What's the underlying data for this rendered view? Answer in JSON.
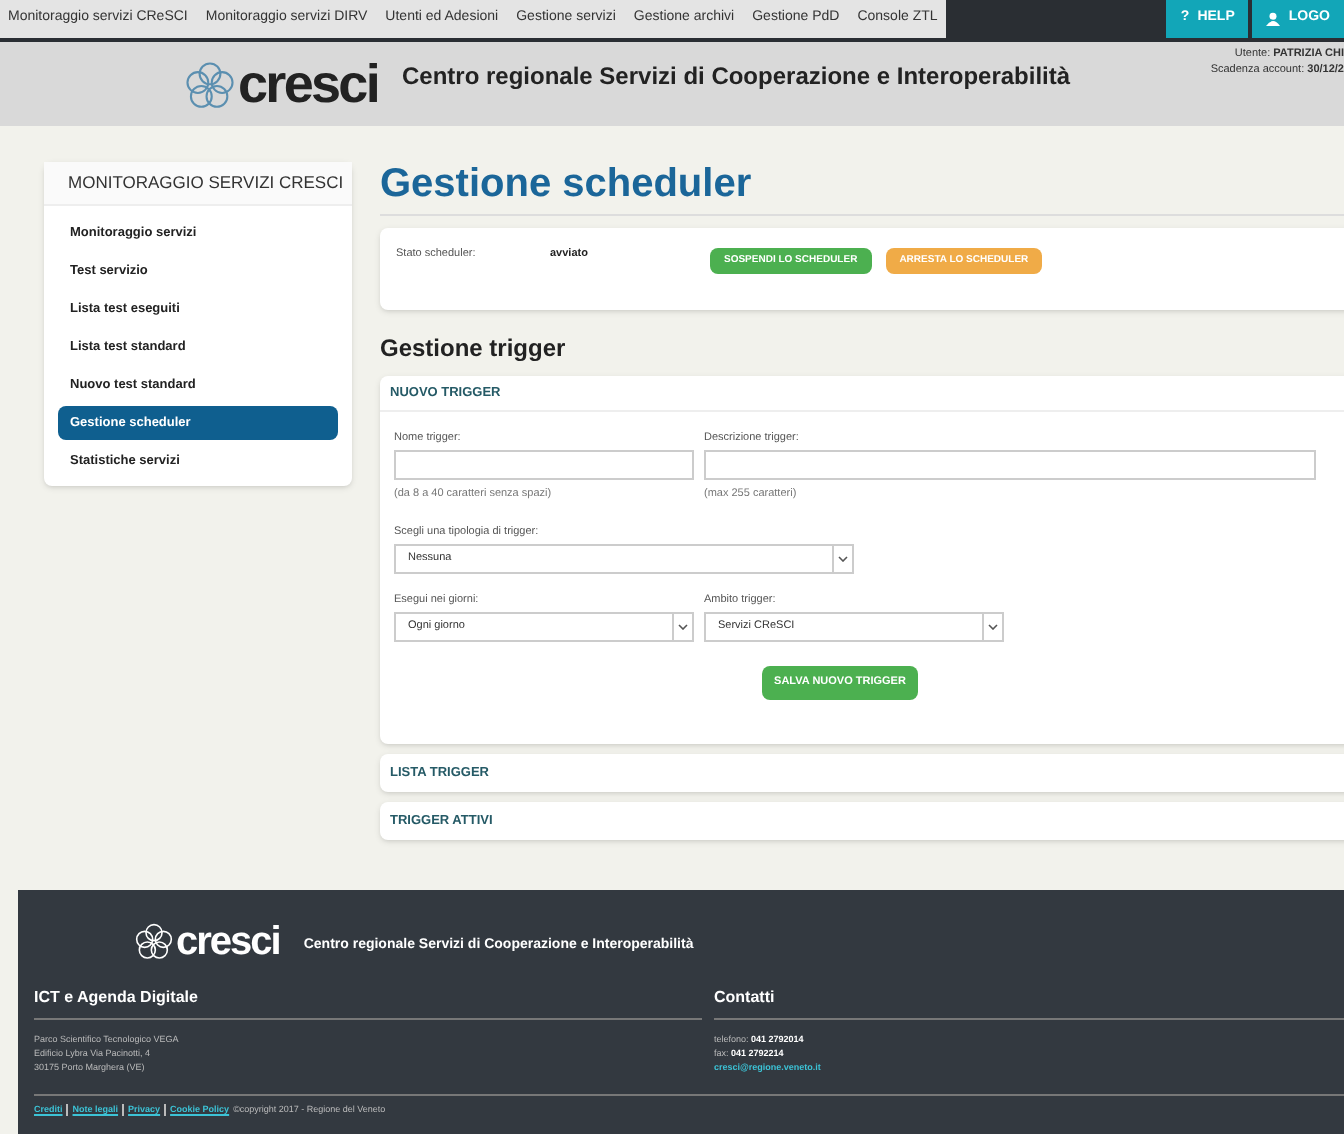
{
  "top_nav": {
    "items": [
      "Monitoraggio servizi CReSCI",
      "Monitoraggio servizi DIRV",
      "Utenti ed Adesioni",
      "Gestione servizi",
      "Gestione archivi",
      "Gestione PdD",
      "Console ZTL"
    ],
    "buttons": [
      {
        "kind": "help",
        "icon": "?",
        "label": "HELP"
      },
      {
        "kind": "logout",
        "label": "LOGO"
      }
    ]
  },
  "header": {
    "logo": "cresci",
    "title": "Centro regionale Servizi di Cooperazione e Interoperabilità",
    "user_label": "Utente:",
    "user": "PATRIZIA CHI",
    "expiry_label": "Scadenza account:",
    "expiry": "30/12/2"
  },
  "sidebar": {
    "title": "MONITORAGGIO SERVIZI CRESCI",
    "items": [
      {
        "label": "Monitoraggio servizi",
        "selected": false
      },
      {
        "label": "Test servizio",
        "selected": false
      },
      {
        "label": "Lista test eseguiti",
        "selected": false
      },
      {
        "label": "Lista test standard",
        "selected": false
      },
      {
        "label": "Nuovo test standard",
        "selected": false
      },
      {
        "label": "Gestione scheduler",
        "selected": true
      },
      {
        "label": "Statistiche servizi",
        "selected": false
      }
    ]
  },
  "page_title": "Gestione scheduler",
  "scheduler": {
    "label": "Stato scheduler:",
    "value": "avviato",
    "buttons": [
      {
        "kind": "green",
        "label": "SOSPENDI LO SCHEDULER"
      },
      {
        "kind": "orange",
        "label": "ARRESTA LO SCHEDULER"
      }
    ]
  },
  "trigger_title": "Gestione trigger",
  "new_trigger": {
    "title": "NUOVO TRIGGER",
    "name": {
      "label": "Nome trigger:",
      "hint": "(da 8 a 40 caratteri senza spazi)"
    },
    "description": {
      "label": "Descrizione trigger:",
      "hint": "(max 255 caratteri)"
    },
    "type": {
      "label": "Scegli una tipologia di trigger:",
      "value": "Nessuna"
    },
    "days": {
      "label": "Esegui nei giorni:",
      "value": "Ogni giorno"
    },
    "scope": {
      "label": "Ambito trigger:",
      "value": "Servizi CReSCI"
    },
    "save": "SALVA NUOVO TRIGGER"
  },
  "panels": [
    "LISTA TRIGGER",
    "TRIGGER ATTIVI"
  ],
  "footer": {
    "logo": "cresci",
    "title": "Centro regionale Servizi di Cooperazione e Interoperabilità",
    "left": {
      "heading": "ICT e Agenda Digitale",
      "lines": [
        "Parco Scientifico Tecnologico VEGA",
        "Edificio Lybra Via Pacinotti, 4",
        "30175 Porto Marghera (VE)"
      ]
    },
    "right": {
      "heading": "Contatti",
      "phone_label": "telefono:",
      "phone": "041 2792014",
      "fax_label": "fax:",
      "fax": "041 2792214",
      "email": "cresci@regione.veneto.it"
    },
    "links": [
      "Crediti",
      "Note legali",
      "Privacy",
      "Cookie Policy"
    ],
    "copyright": "©copyright 2017 - Regione del Veneto"
  }
}
